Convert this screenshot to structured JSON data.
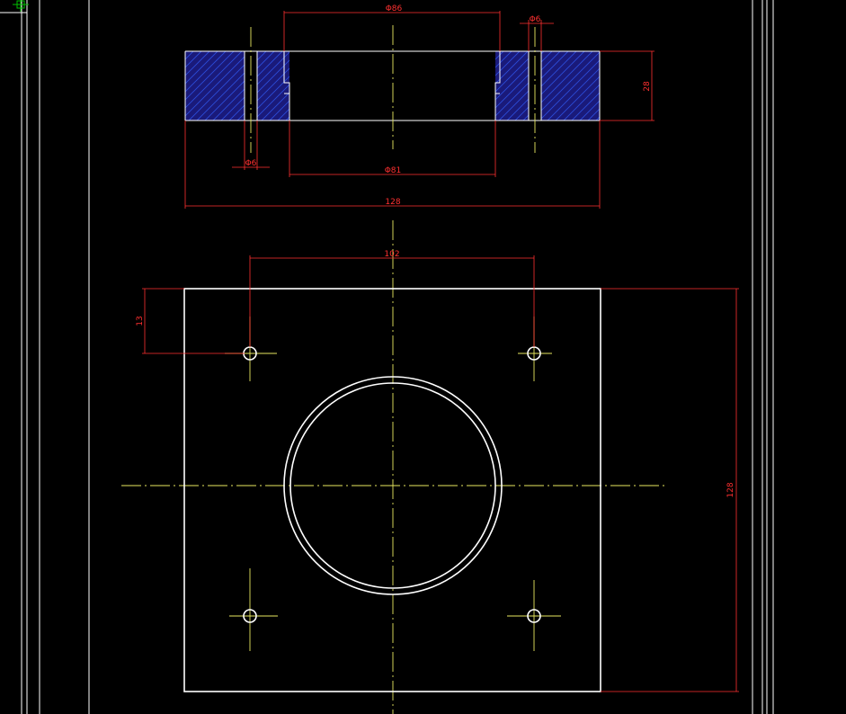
{
  "drawing": {
    "background": "#000000",
    "line_color": "#ffffff",
    "dimension_color": "#ff3030",
    "centerline_color": "#e8e860",
    "hatch_color": "#2c4cd8",
    "hatch_fill": "#1a1a7a",
    "cursor_color": "#00c000"
  },
  "dimensions": {
    "top_bore": "Φ86",
    "top_hole_right": "Φ6",
    "height": "28",
    "bottom_hole_left": "Φ6",
    "bottom_bore": "Φ81",
    "width_section": "128",
    "hole_spacing": "102",
    "hole_offset": "13",
    "height_plan": "128"
  },
  "views": {
    "section_view": "section-view",
    "plan_view": "plan-view"
  }
}
